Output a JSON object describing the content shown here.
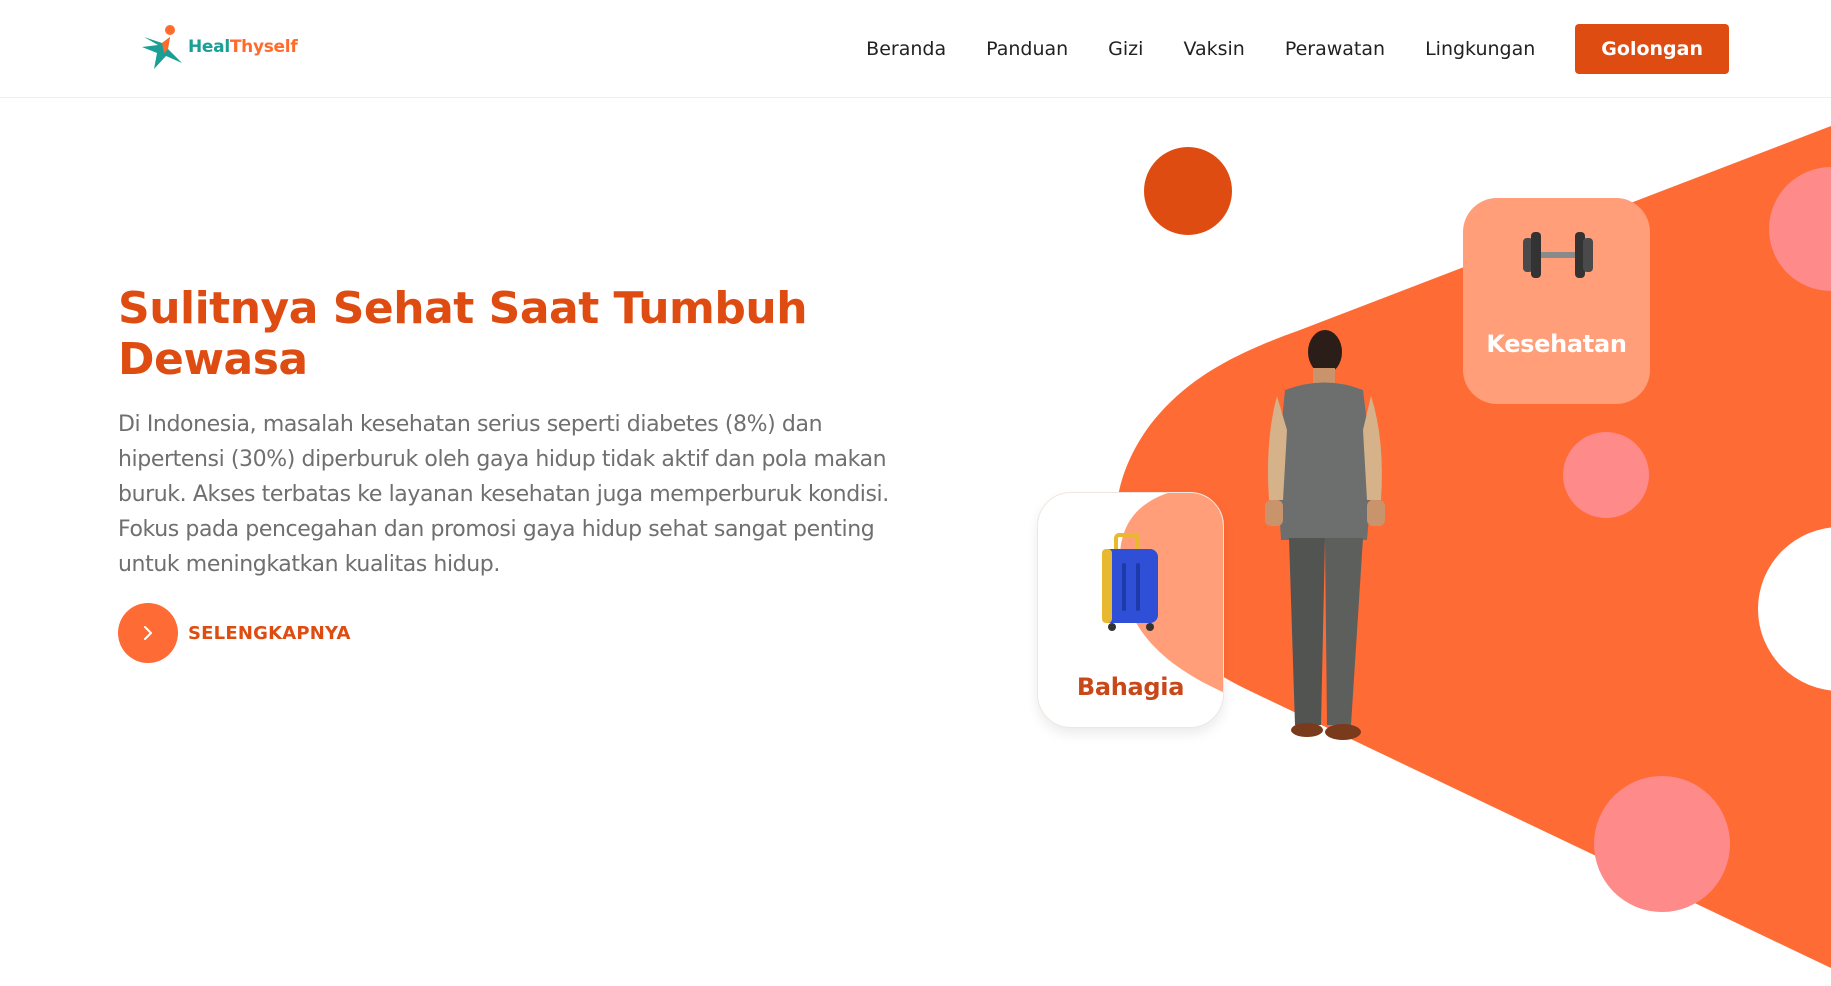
{
  "brand": {
    "name_part1": "Heal",
    "name_part2": "Thyself",
    "logo_icon": "star-person-icon"
  },
  "nav": {
    "items": [
      "Beranda",
      "Panduan",
      "Gizi",
      "Vaksin",
      "Perawatan",
      "Lingkungan"
    ],
    "cta_label": "Golongan"
  },
  "hero": {
    "title": "Sulitnya Sehat Saat Tumbuh Dewasa",
    "description": "Di Indonesia, masalah kesehatan serius seperti diabetes (8%) dan hipertensi (30%) diperburuk oleh gaya hidup tidak aktif dan pola makan buruk. Akses terbatas ke layanan kesehatan juga memperburuk kondisi. Fokus pada pencegahan dan promosi gaya hidup sehat sangat penting untuk meningkatkan kualitas hidup.",
    "more_label": "SELENGKAPNYA",
    "more_icon": "chevron-right-icon"
  },
  "cards": {
    "health": {
      "label": "Kesehatan",
      "icon": "dumbbell-icon"
    },
    "happy": {
      "label": "Bahagia",
      "icon": "suitcase-icon"
    }
  },
  "colors": {
    "accent": "#de4c12",
    "orange": "#ff6b35",
    "pink": "#ff8a8a",
    "teal": "#1a9e96"
  }
}
